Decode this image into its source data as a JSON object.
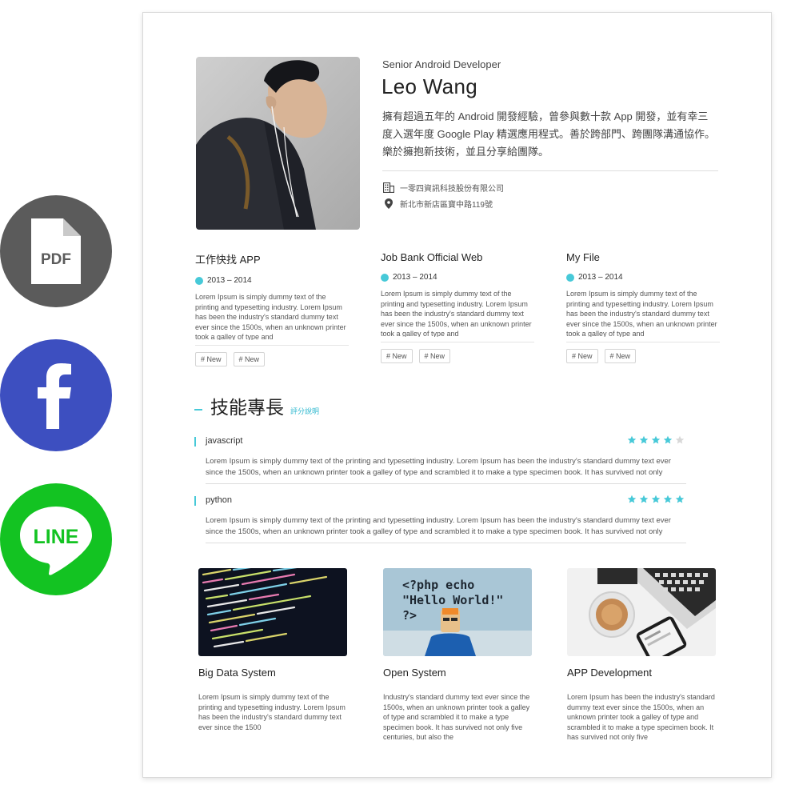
{
  "share": {
    "pdf_label": "PDF",
    "line_label": "LINE",
    "colors": {
      "pdf": "#5b5b5b",
      "facebook": "#3d4fc0",
      "line": "#13c322"
    }
  },
  "profile": {
    "role": "Senior Android Developer",
    "name": "Leo Wang",
    "bio": "擁有超過五年的 Android 開發經驗，曾參與數十款 App 開發，並有幸三度入選年度 Google Play 精選應用程式。善於跨部門、跨團隊溝通協作。樂於擁抱新技術，並且分享給團隊。",
    "company": "一零四資訊科技股份有限公司",
    "address": "新北市新店區寶中路119號"
  },
  "projects": [
    {
      "title": "工作快找 APP",
      "period": "2013 – 2014",
      "desc": "Lorem Ipsum is simply dummy text of the printing and typesetting industry. Lorem Ipsum has been the industry's standard dummy text ever since the 1500s, when an unknown printer took a galley of type and",
      "tags": [
        "# New",
        "# New"
      ]
    },
    {
      "title": "Job Bank Official Web",
      "period": "2013 – 2014",
      "desc": "Lorem Ipsum is simply dummy text of the printing and typesetting industry. Lorem Ipsum has been the industry's standard dummy text ever since the 1500s, when an unknown printer took a galley of type and",
      "tags": [
        "# New",
        "# New"
      ]
    },
    {
      "title": "My File",
      "period": "2013 – 2014",
      "desc": "Lorem Ipsum is simply dummy text of the printing and typesetting industry. Lorem Ipsum has been the industry's standard dummy text ever since the 1500s, when an unknown printer took a galley of type and",
      "tags": [
        "# New",
        "# New"
      ]
    }
  ],
  "skills_section": {
    "title": "技能專長",
    "rating_link": "評分說明",
    "accent": "#47c9d8"
  },
  "skills": [
    {
      "name": "javascript",
      "stars": 4,
      "max_stars": 5,
      "desc": "Lorem Ipsum is simply dummy text of the printing and typesetting industry. Lorem Ipsum has been the industry's standard dummy text ever since the 1500s, when an unknown printer took a galley of type and scrambled it to make a type specimen book. It has survived not only"
    },
    {
      "name": "python",
      "stars": 5,
      "max_stars": 5,
      "desc": "Lorem Ipsum is simply dummy text of the printing and typesetting industry. Lorem Ipsum has been the industry's standard dummy text ever since the 1500s, when an unknown printer took a galley of type and scrambled it to make a type specimen book. It has survived not only"
    }
  ],
  "portfolio": [
    {
      "title": "Big Data System",
      "desc": "Lorem Ipsum is simply dummy text of the printing and typesetting industry. Lorem Ipsum has been the industry's standard dummy text ever since the 1500"
    },
    {
      "title": "Open System",
      "desc": "Industry's standard dummy text ever since the 1500s, when an unknown printer took a galley of type and scrambled it to make a type specimen book. It has survived not only five centuries, but also the",
      "image_text": [
        "<?php echo",
        "\"Hello World!\"",
        "?>"
      ]
    },
    {
      "title": "APP Development",
      "desc": "Lorem Ipsum has been the industry's standard dummy text ever since the 1500s, when an unknown printer took a galley of type and scrambled it to make a type specimen book. It has survived not only five"
    }
  ]
}
